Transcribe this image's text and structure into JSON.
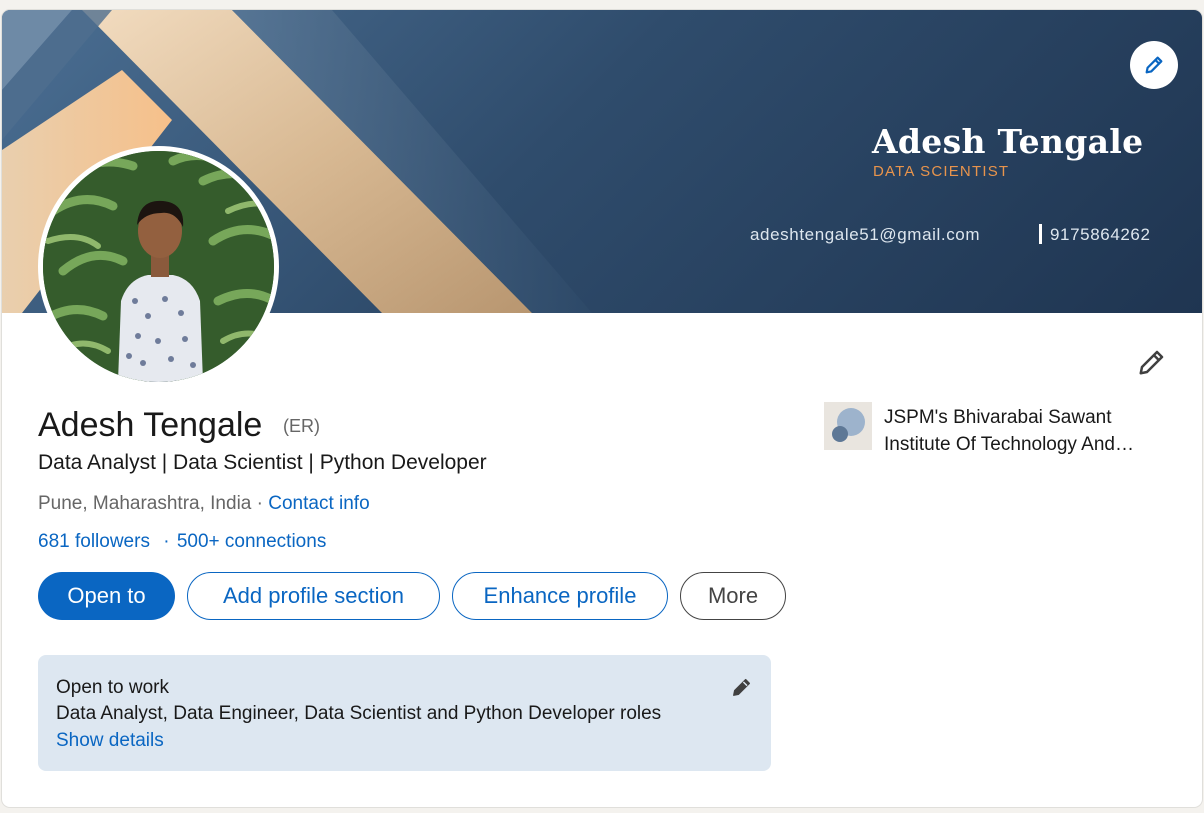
{
  "banner": {
    "name": "Adesh Tengale",
    "title": "DATA SCIENTIST",
    "email": "adeshtengale51@gmail.com",
    "phone": "9175864262",
    "edit_icon": "pencil-icon"
  },
  "profile": {
    "name": "Adesh Tengale",
    "pronouns": "(ER)",
    "headline": "Data Analyst | Data Scientist | Python Developer",
    "location": "Pune, Maharashtra, India",
    "location_sep": "·",
    "contact_info": "Contact info",
    "followers": "681 followers",
    "network_sep": "·",
    "connections": "500+ connections",
    "edit_icon": "pencil-icon"
  },
  "actions": {
    "open_to": "Open to",
    "add_section": "Add profile section",
    "enhance": "Enhance profile",
    "more": "More"
  },
  "education": {
    "school": "JSPM's Bhivarabai Sawant Institute Of Technology And Research"
  },
  "open_to_work": {
    "title": "Open to work",
    "roles": "Data Analyst, Data Engineer, Data Scientist and Python Developer roles",
    "link": "Show details",
    "edit_icon": "pencil-icon"
  },
  "colors": {
    "accent": "#0a66c2",
    "banner_title": "#e8944c",
    "open_to_work_bg": "#dde7f1"
  }
}
